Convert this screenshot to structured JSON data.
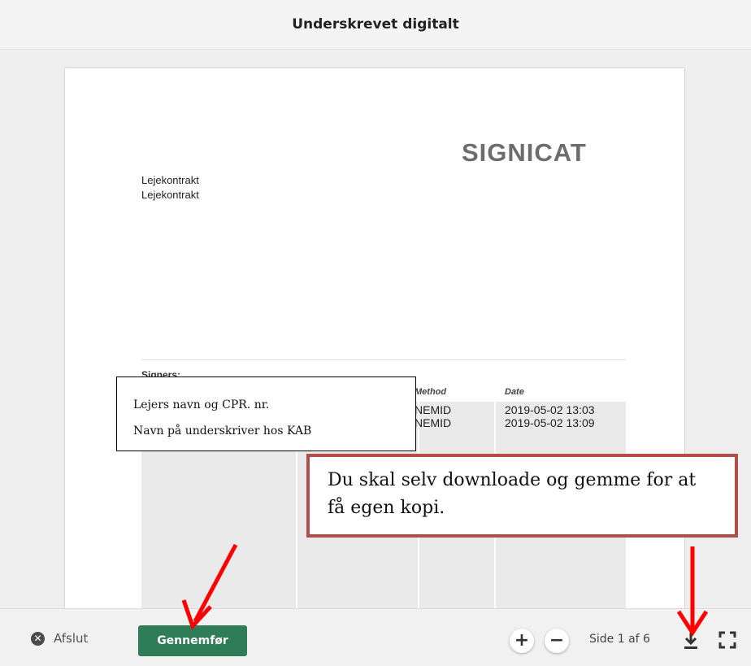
{
  "header": {
    "title": "Underskrevet digitalt"
  },
  "document": {
    "logo": "SIGNICAT",
    "lines": [
      "Lejekontrakt",
      "Lejekontrakt"
    ],
    "signers_label": "Signers:",
    "columns": {
      "method": "Method",
      "date": "Date"
    },
    "rows": [
      {
        "method": "NEMID",
        "date": "2019-05-02 13:03"
      },
      {
        "method": "NEMID",
        "date": "2019-05-02 13:09"
      }
    ]
  },
  "annotations": {
    "signers_box": [
      "Lejers navn og CPR. nr.",
      "Navn på underskriver hos KAB"
    ],
    "download_note": "Du skal selv downloade og gemme for at få egen kopi.",
    "arrow_color": "#ff0000"
  },
  "footer": {
    "close_label": "Afslut",
    "submit_label": "Gennemfør",
    "page_indicator": "Side 1 af 6",
    "zoom_in": "+",
    "zoom_out": "−"
  },
  "colors": {
    "primary_button": "#2e7d57",
    "callout_border": "#b14e4b"
  }
}
